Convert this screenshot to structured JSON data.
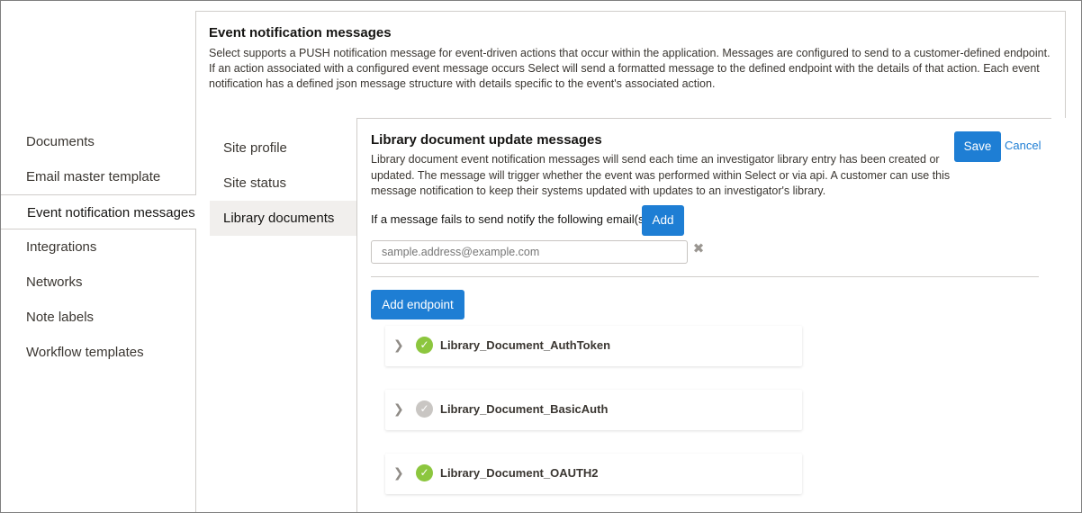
{
  "left_nav": {
    "items": [
      {
        "label": "Documents"
      },
      {
        "label": "Email master template"
      },
      {
        "label": "Event notification messages",
        "active": true
      },
      {
        "label": "Integrations"
      },
      {
        "label": "Networks"
      },
      {
        "label": "Note labels"
      },
      {
        "label": "Workflow templates"
      }
    ]
  },
  "header": {
    "title": "Event notification messages",
    "description": "Select supports a PUSH notification message for event-driven actions that occur within the application. Messages are configured to send to a customer-defined endpoint. If an action associated with a configured event message occurs Select will send a formatted message to the defined endpoint with the details of that action. Each event notification has a defined json message structure with details specific to the event's associated action."
  },
  "sub_nav": {
    "items": [
      {
        "label": "Site profile"
      },
      {
        "label": "Site status"
      },
      {
        "label": "Library documents",
        "active": true
      }
    ]
  },
  "panel": {
    "title": "Library document update messages",
    "description": "Library document event notification messages will send each time an investigator library entry has been created or updated. The message will trigger whether the event was performed within Select or via api. A customer can use this message notification to keep their systems updated with updates to an investigator's library.",
    "save_label": "Save",
    "cancel_label": "Cancel",
    "notify_label": "If a message fails to send notify the following email(s):",
    "add_label": "Add",
    "email_placeholder": "sample.address@example.com",
    "clear_icon": "close-icon",
    "add_endpoint_label": "Add endpoint"
  },
  "endpoints": [
    {
      "name": "Library_Document_AuthToken",
      "status": "enabled",
      "status_icon": "check-circle-icon"
    },
    {
      "name": "Library_Document_BasicAuth",
      "status": "disabled",
      "status_icon": "check-circle-icon"
    },
    {
      "name": "Library_Document_OAUTH2",
      "status": "enabled",
      "status_icon": "check-circle-icon"
    }
  ],
  "colors": {
    "primary": "#1e7ed4",
    "enabled": "#8cc63e",
    "disabled": "#c9c6c3",
    "active_bg": "#f1efed"
  }
}
